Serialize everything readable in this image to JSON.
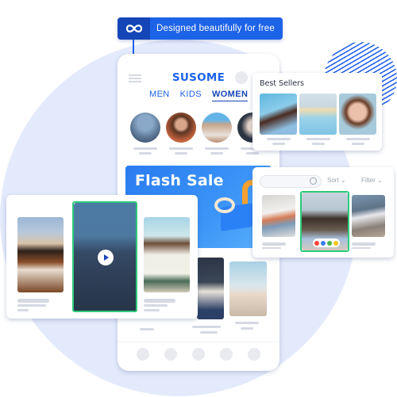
{
  "badge": {
    "icon": "infinity-icon",
    "text": "Designed beautifully for free"
  },
  "app": {
    "brand": "SUSOME",
    "tabs": [
      {
        "label": "MEN",
        "active": false
      },
      {
        "label": "KIDS",
        "active": false
      },
      {
        "label": "WOMEN",
        "active": true
      }
    ],
    "banner": {
      "title": "Flash Sale"
    }
  },
  "best_sellers": {
    "title": "Best Sellers"
  },
  "filter_panel": {
    "sort_label": "Sort",
    "filter_label": "Filter",
    "search_placeholder": ""
  },
  "colors": {
    "accent": "#1d63e8",
    "accent_dark": "#1546b8",
    "selected_border": "#2ecb7a",
    "swatches": [
      "#f0443a",
      "#3a7bf0",
      "#44b449",
      "#f5c518"
    ]
  }
}
